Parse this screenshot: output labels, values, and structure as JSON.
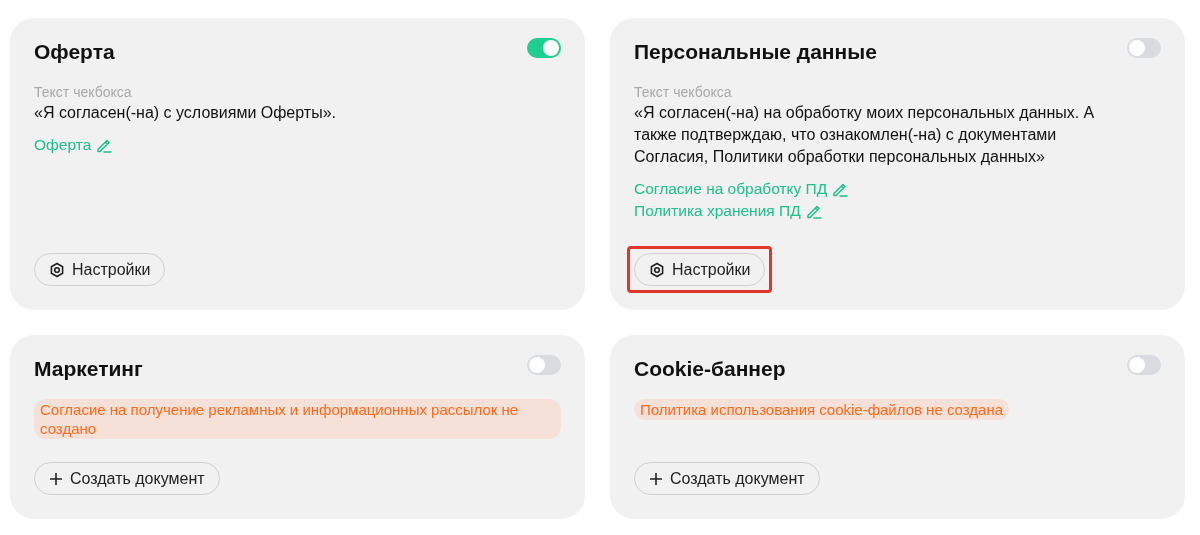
{
  "cards": [
    {
      "kind": "document",
      "title": "Оферта",
      "on": true,
      "caption": "Текст чекбокса",
      "text": "«Я согласен(-на) с условиями Оферты».",
      "links": [
        "Оферта"
      ],
      "button": {
        "kind": "settings",
        "label": "Настройки",
        "highlighted": false
      }
    },
    {
      "kind": "document",
      "title": "Персональные данные",
      "on": false,
      "caption": "Текст чекбокса",
      "text": "«Я согласен(-на) на обработку моих персональных данных. А также подтверждаю, что ознакомлен(-на) с документами Согласия, Политики обработки персональных данных»",
      "links": [
        "Согласие на обработку ПД",
        "Политика хранения ПД"
      ],
      "button": {
        "kind": "settings",
        "label": "Настройки",
        "highlighted": true
      }
    },
    {
      "kind": "missing",
      "title": "Маркетинг",
      "on": false,
      "warning": "Согласие на получение рекламных и информационных рассылок не создано",
      "button": {
        "kind": "create",
        "label": "Создать документ",
        "highlighted": false
      }
    },
    {
      "kind": "missing",
      "title": "Cookie-баннер",
      "on": false,
      "warning": "Политика использования cookie-файлов не создана",
      "button": {
        "kind": "create",
        "label": "Создать документ",
        "highlighted": false
      }
    }
  ]
}
